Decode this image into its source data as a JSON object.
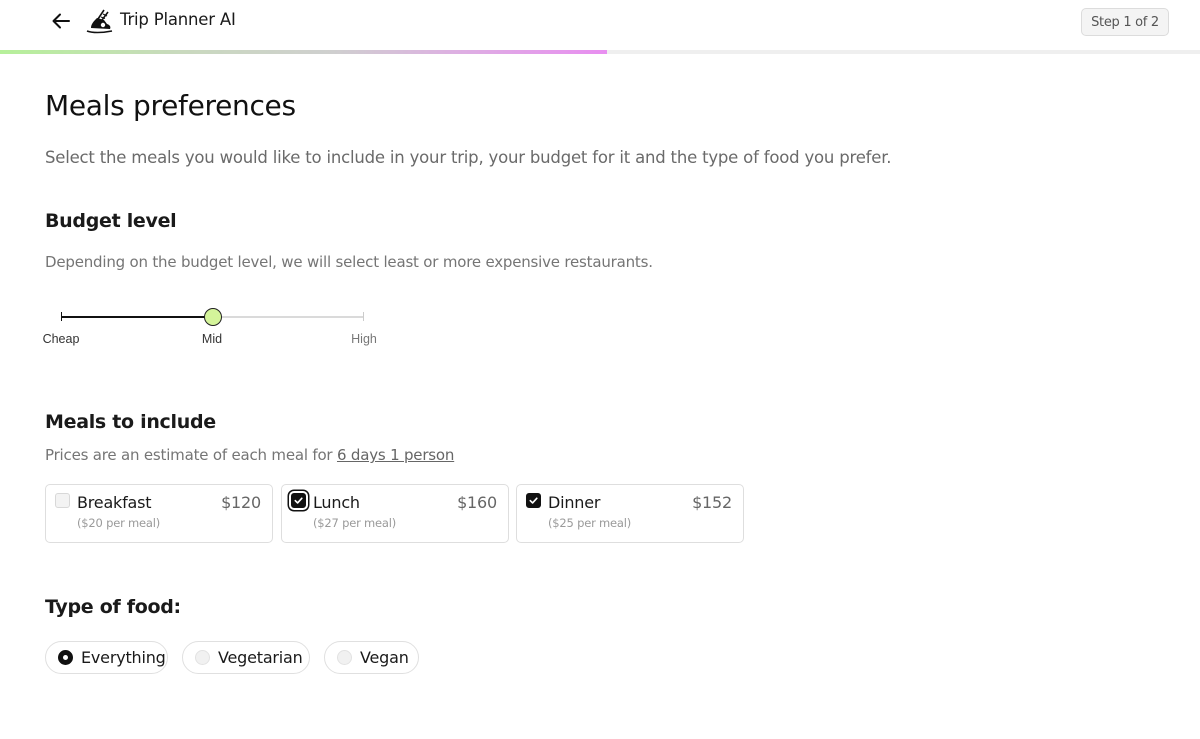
{
  "header": {
    "back_label": "Back",
    "logo_icon": "ski-boot-icon",
    "app_title": "Trip Planner AI",
    "step_badge": "Step 1 of 2",
    "progress_percent": 50.6,
    "progress_colors": [
      "#b6f09a",
      "#cfcfcf",
      "#e88ef0"
    ]
  },
  "page": {
    "title": "Meals preferences",
    "description": "Select the meals you would like to include in your trip, your budget for it and the type of food you prefer."
  },
  "budget": {
    "heading": "Budget level",
    "description": "Depending on the budget level, we will select least or more expensive restaurants.",
    "levels": [
      "Cheap",
      "Mid",
      "High"
    ],
    "selected_index": 1,
    "thumb_color": "#d4f49a"
  },
  "meals": {
    "heading": "Meals to include",
    "description_prefix": "Prices are an estimate of each meal for ",
    "description_link": "6 days 1 person",
    "items": [
      {
        "name": "Breakfast",
        "total": "$120",
        "per_meal": "($20 per meal)",
        "checked": false,
        "focused": false
      },
      {
        "name": "Lunch",
        "total": "$160",
        "per_meal": "($27 per meal)",
        "checked": true,
        "focused": true
      },
      {
        "name": "Dinner",
        "total": "$152",
        "per_meal": "($25 per meal)",
        "checked": true,
        "focused": false
      }
    ]
  },
  "food_type": {
    "heading": "Type of food:",
    "options": [
      {
        "label": "Everything",
        "selected": true
      },
      {
        "label": "Vegetarian",
        "selected": false
      },
      {
        "label": "Vegan",
        "selected": false
      }
    ]
  }
}
